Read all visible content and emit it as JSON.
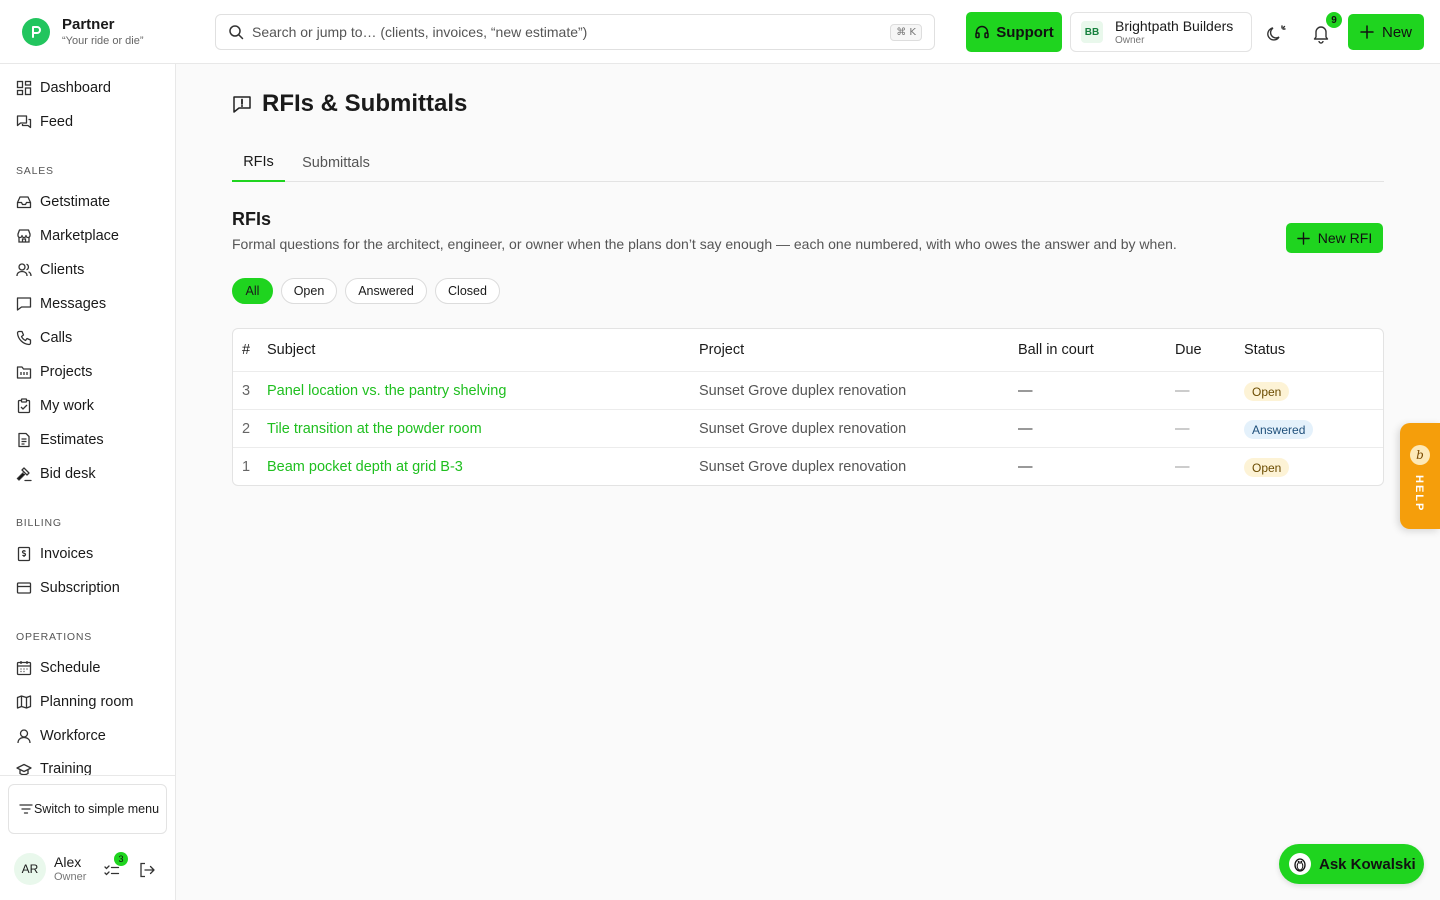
{
  "brand": {
    "name": "Partner",
    "tagline": "“Your ride or die”"
  },
  "search": {
    "placeholder": "Search or jump to… (clients, invoices, “new estimate”)",
    "shortcut": "⌘ K"
  },
  "header": {
    "support_label": "Support",
    "company_initials": "BB",
    "company_name": "Brightpath Builders",
    "company_role": "Owner",
    "notifications_count": "9",
    "new_label": "New"
  },
  "sidebar": {
    "top_items": [
      {
        "label": "Dashboard",
        "icon": "dashboard-icon"
      },
      {
        "label": "Feed",
        "icon": "feed-icon"
      }
    ],
    "sales_label": "SALES",
    "sales_items": [
      {
        "label": "Getstimate",
        "icon": "inbox-icon"
      },
      {
        "label": "Marketplace",
        "icon": "store-icon"
      },
      {
        "label": "Clients",
        "icon": "users-icon"
      },
      {
        "label": "Messages",
        "icon": "message-icon"
      },
      {
        "label": "Calls",
        "icon": "phone-icon"
      },
      {
        "label": "Projects",
        "icon": "folder-icon"
      },
      {
        "label": "My work",
        "icon": "clipboard-icon"
      },
      {
        "label": "Estimates",
        "icon": "document-icon"
      },
      {
        "label": "Bid desk",
        "icon": "gavel-icon"
      }
    ],
    "billing_label": "BILLING",
    "billing_items": [
      {
        "label": "Invoices",
        "icon": "invoice-icon"
      },
      {
        "label": "Subscription",
        "icon": "card-icon"
      }
    ],
    "operations_label": "OPERATIONS",
    "operations_items": [
      {
        "label": "Schedule",
        "icon": "calendar-icon"
      },
      {
        "label": "Planning room",
        "icon": "map-icon"
      },
      {
        "label": "Workforce",
        "icon": "worker-icon"
      },
      {
        "label": "Training",
        "icon": "graduation-icon"
      }
    ],
    "simple_menu_label": "Switch to simple menu",
    "user": {
      "initials": "AR",
      "name": "Alex",
      "role": "Owner",
      "tasks_count": "3"
    }
  },
  "page": {
    "title": "RFIs & Submittals",
    "tabs": [
      {
        "label": "RFIs",
        "active": true
      },
      {
        "label": "Submittals",
        "active": false
      }
    ],
    "section_title": "RFIs",
    "section_desc": "Formal questions for the architect, engineer, or owner when the plans don’t say enough — each one numbered, with who owes the answer and by when.",
    "new_rfi_label": "New RFI",
    "filters": [
      {
        "label": "All",
        "active": true
      },
      {
        "label": "Open",
        "active": false
      },
      {
        "label": "Answered",
        "active": false
      },
      {
        "label": "Closed",
        "active": false
      }
    ]
  },
  "table": {
    "headers": {
      "num": "#",
      "subject": "Subject",
      "project": "Project",
      "ball": "Ball in court",
      "due": "Due",
      "status": "Status"
    },
    "rows": [
      {
        "num": "3",
        "subject": "Panel location vs. the pantry shelving",
        "project": "Sunset Grove duplex renovation",
        "ball": "—",
        "due": "—",
        "status": "Open"
      },
      {
        "num": "2",
        "subject": "Tile transition at the powder room",
        "project": "Sunset Grove duplex renovation",
        "ball": "—",
        "due": "—",
        "status": "Answered"
      },
      {
        "num": "1",
        "subject": "Beam pocket depth at grid B-3",
        "project": "Sunset Grove duplex renovation",
        "ball": "—",
        "due": "—",
        "status": "Open"
      }
    ]
  },
  "help": {
    "badge": "b",
    "label": "HELP"
  },
  "assistant": {
    "label": "Ask Kowalski"
  },
  "colors": {
    "accent": "#1fd41f",
    "link": "#1fbf1f",
    "help": "#f59e0b"
  }
}
